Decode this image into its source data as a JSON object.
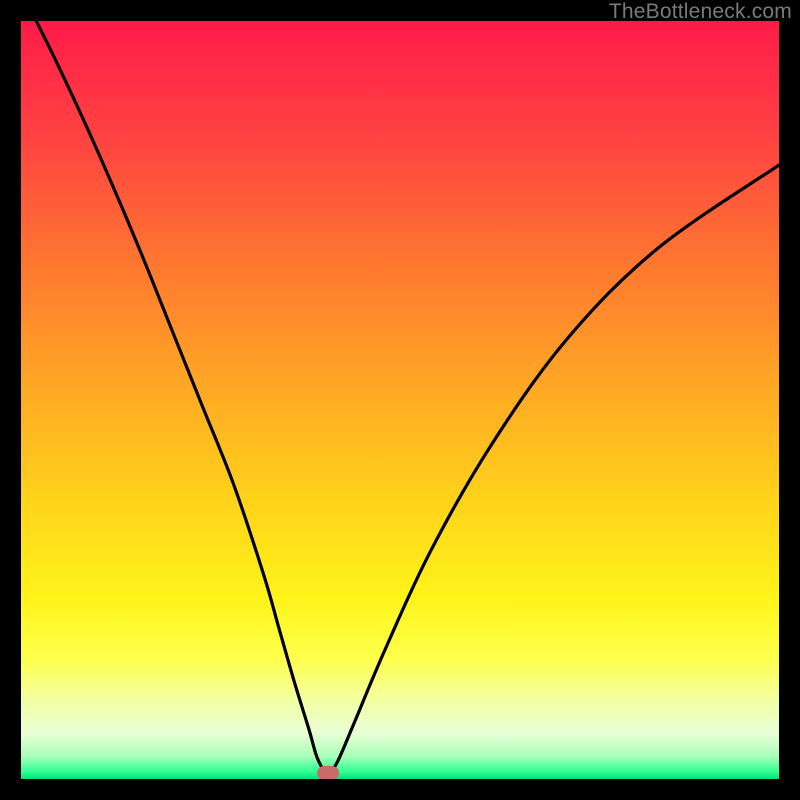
{
  "watermark": "TheBottleneck.com",
  "marker": {
    "x_frac": 0.405,
    "y_frac": 0.992
  },
  "chart_data": {
    "type": "line",
    "title": "",
    "xlabel": "",
    "ylabel": "",
    "xlim": [
      0,
      100
    ],
    "ylim": [
      0,
      100
    ],
    "series": [
      {
        "name": "bottleneck-curve",
        "x": [
          0,
          4,
          8,
          12,
          16,
          20,
          24,
          28,
          32,
          34,
          36,
          38,
          39,
          40,
          40.5,
          41,
          42,
          44,
          48,
          54,
          62,
          72,
          84,
          100
        ],
        "y": [
          104,
          96,
          87.5,
          78.5,
          69,
          59,
          49,
          39,
          27,
          20,
          13,
          6.5,
          3,
          1,
          0.6,
          1,
          2.8,
          7.5,
          17,
          30,
          44,
          58,
          70,
          81
        ]
      }
    ],
    "gradient_note": "Background encodes bottleneck severity: top (red) = high bottleneck, bottom (green) = no bottleneck.",
    "optimum_point": {
      "x": 40.5,
      "y": 0.6
    }
  }
}
